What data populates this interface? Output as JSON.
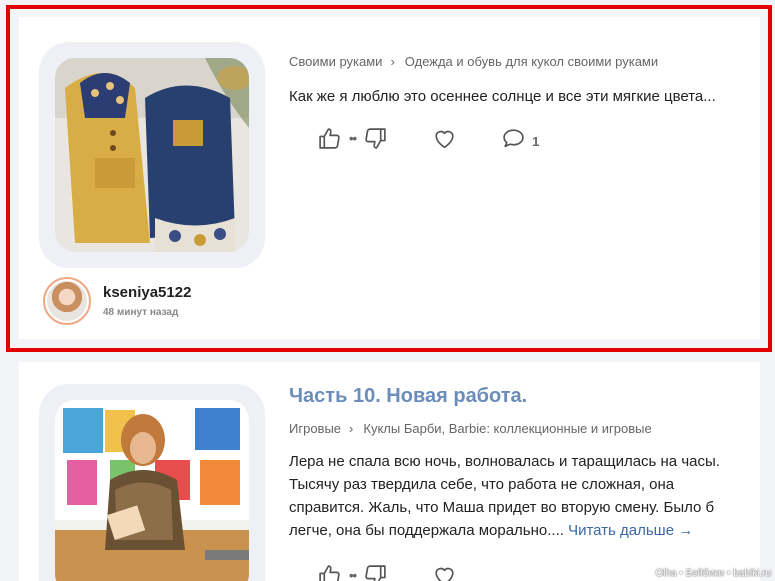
{
  "posts": [
    {
      "breadcrumbs": [
        "Своими руками",
        "Одежда и обувь для кукол своими руками"
      ],
      "excerpt": "Как же я люблю это осеннее солнце и все эти мягкие цвета...",
      "score": "••",
      "comments": "1",
      "author": {
        "name": "kseniya5122",
        "time": "48 минут назад"
      }
    },
    {
      "title": "Часть 10. Новая работа.",
      "breadcrumbs": [
        "Игровые",
        "Куклы Барби, Barbie: коллекционные и игровые"
      ],
      "excerpt": "Лера не спала всю ночь, волновалась и таращилась на часы. Тысячу раз твердила себе, что работа не сложная, она справится. Жаль, что Маша придет во вторую смену. Было б легче, она бы поддержала морально.... ",
      "read_more": "Читать дальше →",
      "score": "••"
    }
  ],
  "breadcrumb_separator": "›",
  "icons": [
    "thumbs-up-icon",
    "thumbs-down-icon",
    "heart-icon",
    "comment-icon"
  ],
  "watermark": "Olha • Бэйбики • babiki.ru",
  "colors": {
    "title": "#6a8dba",
    "highlight": "#e30000",
    "link": "#3b68a8"
  }
}
